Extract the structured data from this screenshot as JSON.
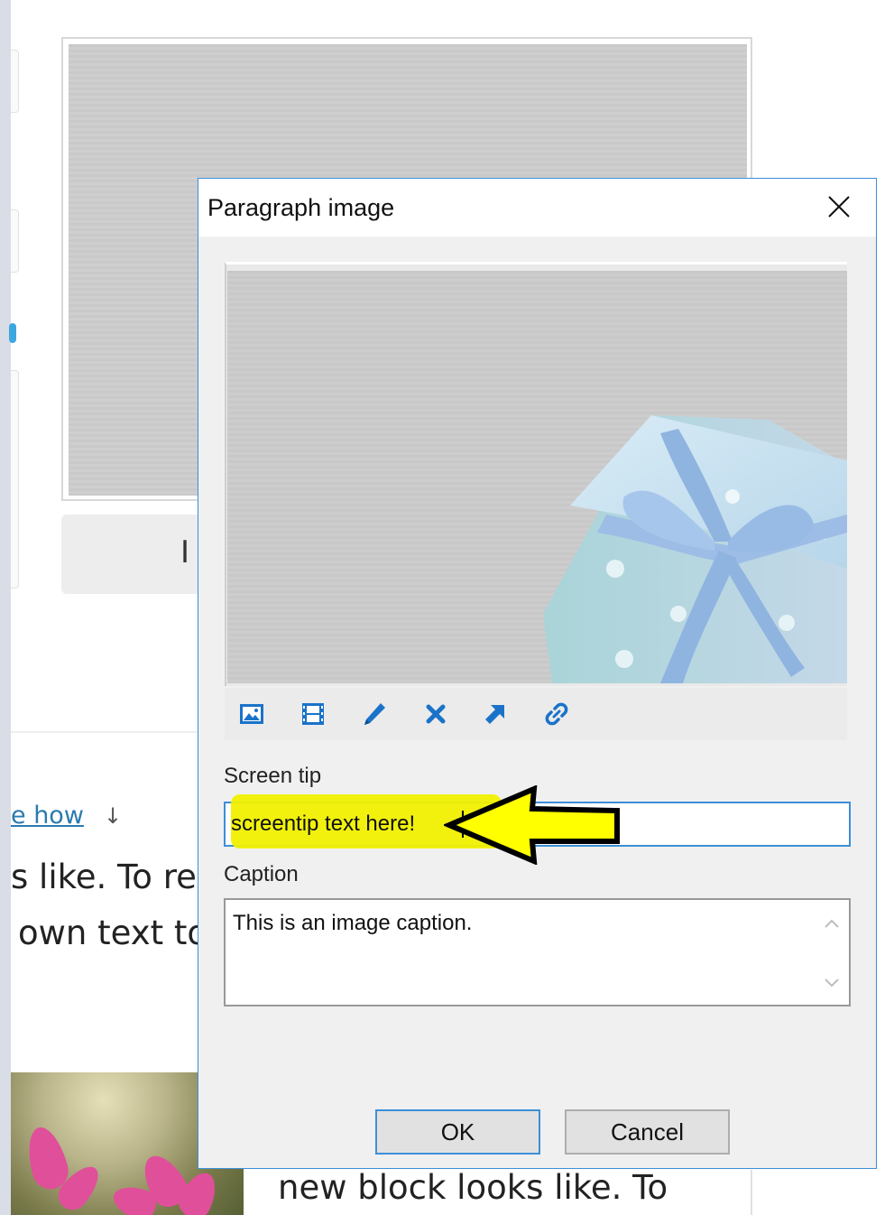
{
  "dialog": {
    "title": "Paragraph image",
    "screen_tip_label": "Screen tip",
    "screen_tip_value": "screentip text here!",
    "caption_label": "Caption",
    "caption_value": "This is an image caption.",
    "ok_label": "OK",
    "cancel_label": "Cancel",
    "toolbar_icons": [
      "insert-picture-icon",
      "insert-video-icon",
      "edit-pencil-icon",
      "delete-icon",
      "open-external-icon",
      "link-icon"
    ]
  },
  "background": {
    "insert_button_partial": "I",
    "see_how_link": "e how",
    "arrow_glyph": "↓",
    "text_line_1": "s like. To re",
    "text_line_2": "own text to",
    "text_line_3": "new block looks like. To"
  },
  "colors": {
    "accent": "#3c8fd8",
    "highlight": "#f0f000",
    "toolbar_icon": "#1a73c9"
  }
}
